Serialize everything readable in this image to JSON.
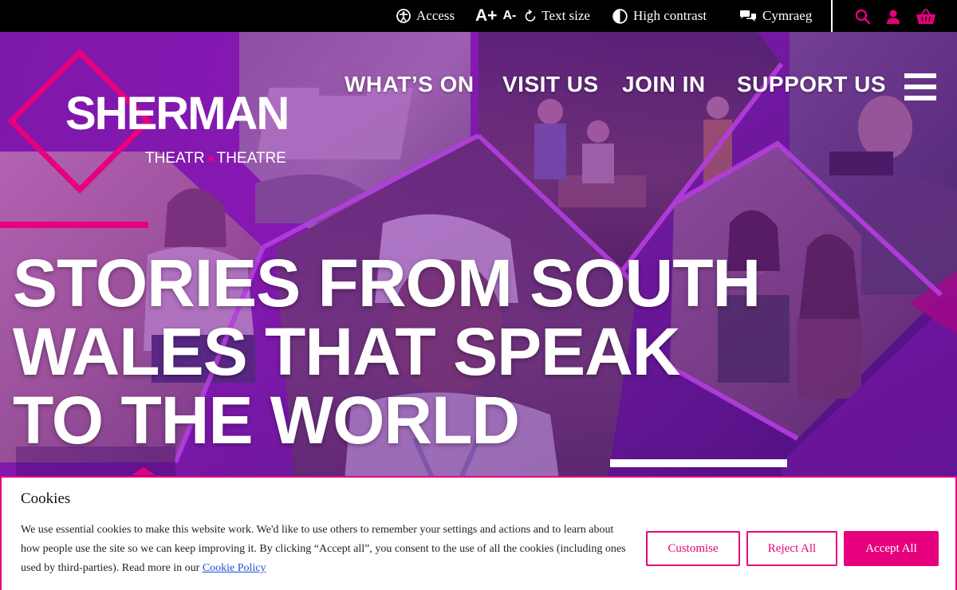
{
  "topbar": {
    "access_label": "Access",
    "text_size_big": "A+",
    "text_size_small": "A-",
    "text_size_label": "Text size",
    "contrast_label": "High contrast",
    "language_label": "Cymraeg"
  },
  "logo": {
    "name": "SHERMAN",
    "sub_left": "THEATR",
    "sub_right": "THEATRE"
  },
  "nav": {
    "items": [
      "WHAT’S ON",
      "VISIT US",
      "JOIN IN",
      "SUPPORT US"
    ]
  },
  "hero": {
    "headline_lines": [
      "STORIES FROM SOUTH",
      "WALES THAT SPEAK",
      "TO THE WORLD"
    ]
  },
  "cookie": {
    "title": "Cookies",
    "text": "We use essential cookies to make this website work. We'd like to use others to remember your settings and actions and to learn about how people use the site so we can keep improving it. By clicking “Accept all”, you consent to the use of all the cookies (including ones used by third-parties). Read more in our ",
    "link_label": "Cookie Policy",
    "customise_label": "Customise",
    "reject_label": "Reject All",
    "accept_label": "Accept All"
  },
  "colors": {
    "brand_pink": "#e6007e",
    "brand_purple": "#7a1aa8",
    "topbar_bg": "#000000"
  },
  "icons": [
    "accessibility-icon",
    "refresh-icon",
    "contrast-icon",
    "speech-bubbles-icon",
    "search-icon",
    "user-icon",
    "basket-icon",
    "menu-icon"
  ]
}
